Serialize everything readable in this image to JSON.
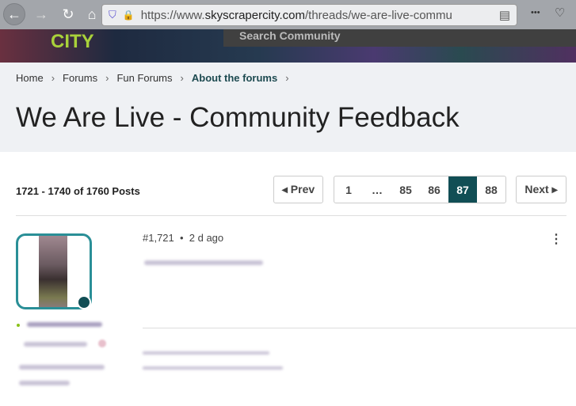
{
  "browser": {
    "url_prefix": "https://www.",
    "url_domain": "skyscrapercity.com",
    "url_path": "/threads/we-are-live-commu",
    "back": "←",
    "forward": "→",
    "reload": "↻",
    "home": "⌂",
    "more": "•••"
  },
  "site": {
    "logo": "CITY",
    "search_placeholder": "Search Community"
  },
  "breadcrumb": [
    {
      "label": "Home"
    },
    {
      "label": "Forums"
    },
    {
      "label": "Fun Forums"
    },
    {
      "label": "About the forums"
    }
  ],
  "page_title": "We Are Live - Community Feedback",
  "pagination": {
    "summary": "1721 - 1740 of 1760 Posts",
    "prev": "◂ Prev",
    "next": "Next ▸",
    "pages": [
      "1",
      "…",
      "85",
      "86",
      "87",
      "88"
    ],
    "current": "87"
  },
  "post": {
    "number": "#1,721",
    "time": "2 d ago",
    "accent": "#114e55"
  }
}
